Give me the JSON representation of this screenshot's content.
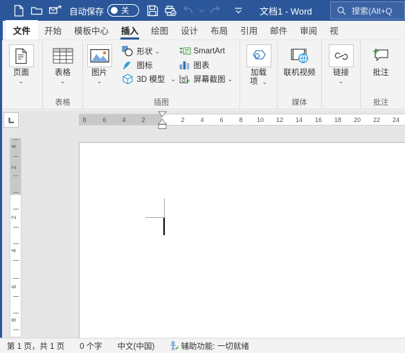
{
  "titlebar": {
    "quick_access": [
      {
        "name": "new-document-icon",
        "label": "新建"
      },
      {
        "name": "open-folder-icon",
        "label": "打开"
      },
      {
        "name": "email-send-icon",
        "label": "电子邮件"
      }
    ],
    "autosave_label": "自动保存",
    "autosave_state": "关",
    "save_label": "保存",
    "print_preview_label": "打印预览和打印",
    "undo_label": "撤消",
    "undo_dropdown_label": "撤消下拉",
    "redo_label": "恢复",
    "customize_qat_label": "自定义快速访问工具栏",
    "document_title": "文档1  -  Word",
    "search_placeholder": "搜索(Alt+Q",
    "accent_color": "#2b579a"
  },
  "tabs": [
    {
      "label": "文件",
      "active": false,
      "is_file": true
    },
    {
      "label": "开始",
      "active": false
    },
    {
      "label": "模板中心",
      "active": false
    },
    {
      "label": "插入",
      "active": true
    },
    {
      "label": "绘图",
      "active": false
    },
    {
      "label": "设计",
      "active": false
    },
    {
      "label": "布局",
      "active": false
    },
    {
      "label": "引用",
      "active": false
    },
    {
      "label": "邮件",
      "active": false
    },
    {
      "label": "审阅",
      "active": false
    },
    {
      "label": "视",
      "active": false
    }
  ],
  "ribbon": {
    "groups": [
      {
        "name": "pages",
        "label": "",
        "big_buttons": [
          {
            "name": "pages-button",
            "label": "页面",
            "label2": "",
            "caret": "⌄",
            "icon": "page-icon",
            "boxed": true
          }
        ]
      },
      {
        "name": "tables",
        "label": "表格",
        "big_buttons": [
          {
            "name": "table-button",
            "label": "表格",
            "label2": "",
            "caret": "⌄",
            "icon": "table-icon",
            "boxed": false
          }
        ]
      },
      {
        "name": "illustrations",
        "label": "插图",
        "big_buttons": [
          {
            "name": "pictures-button",
            "label": "图片",
            "label2": "",
            "caret": "⌄",
            "icon": "picture-icon",
            "boxed": true
          }
        ],
        "small_buttons": [
          {
            "name": "shapes-button",
            "label": "形状",
            "icon": "shapes-icon",
            "caret": "⌄"
          },
          {
            "name": "icons-button",
            "label": "图标",
            "icon": "icons-icon",
            "caret": ""
          },
          {
            "name": "model3d-button",
            "label": "3D 模型",
            "icon": "model3d-icon",
            "caret": "⌄"
          }
        ],
        "small_buttons2": [
          {
            "name": "smartart-button",
            "label": "SmartArt",
            "icon": "smartart-icon",
            "caret": ""
          },
          {
            "name": "chart-button",
            "label": "图表",
            "icon": "chart-icon",
            "caret": ""
          },
          {
            "name": "screenshot-button",
            "label": "屏幕截图",
            "icon": "screenshot-icon",
            "caret": "⌄"
          }
        ]
      },
      {
        "name": "addins",
        "label": "",
        "big_buttons": [
          {
            "name": "addins-button",
            "label": "加载",
            "label2": "项",
            "caret": "⌄",
            "icon": "addin-icon",
            "boxed": true
          }
        ]
      },
      {
        "name": "media",
        "label": "媒体",
        "big_buttons": [
          {
            "name": "online-video-button",
            "label": "联机视频",
            "label2": "",
            "caret": "",
            "icon": "online-video-icon",
            "boxed": false
          }
        ]
      },
      {
        "name": "links",
        "label": "",
        "big_buttons": [
          {
            "name": "link-button",
            "label": "链接",
            "label2": "",
            "caret": "⌄",
            "icon": "link-icon",
            "boxed": true
          }
        ]
      },
      {
        "name": "comments",
        "label": "批注",
        "big_buttons": [
          {
            "name": "new-comment-button",
            "label": "批注",
            "label2": "",
            "caret": "",
            "icon": "comment-icon",
            "boxed": false
          }
        ]
      }
    ]
  },
  "ruler": {
    "tab_stop_selector": "L",
    "horizontal": {
      "margin_ticks": [
        "8",
        "6",
        "4",
        "2"
      ],
      "body_ticks": [
        "2",
        "4",
        "6",
        "8",
        "10",
        "12",
        "14",
        "16",
        "18",
        "20",
        "22",
        "24"
      ]
    },
    "vertical": {
      "margin_ticks": [
        "4",
        "2"
      ],
      "body_ticks": [
        "2",
        "4",
        "6",
        "8"
      ]
    }
  },
  "statusbar": {
    "page_info": "第 1 页，共 1 页",
    "word_count": "0 个字",
    "language": "中文(中国)",
    "accessibility": "辅助功能: 一切就绪"
  }
}
